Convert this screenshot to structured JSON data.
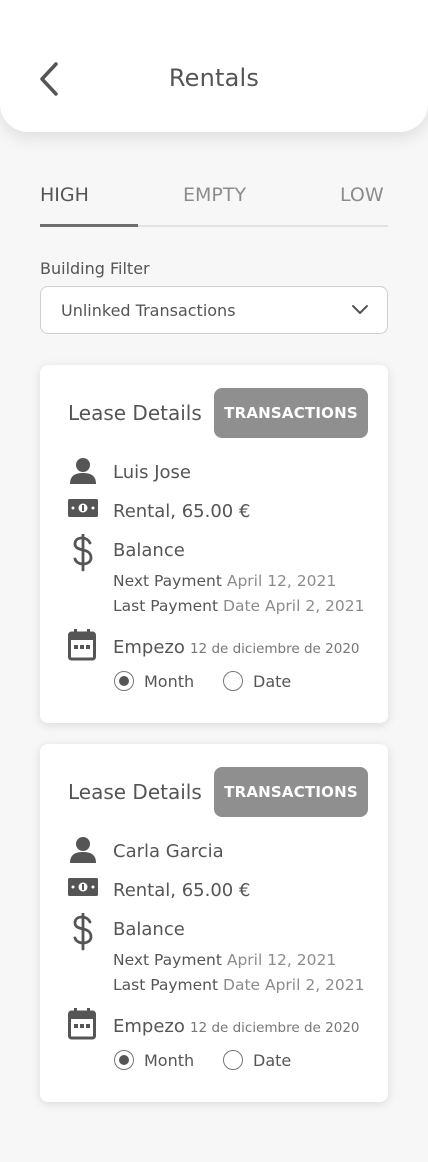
{
  "header": {
    "title": "Rentals",
    "back_icon": "chevron-left-icon"
  },
  "tabs": [
    {
      "label": "HIGH",
      "active": true
    },
    {
      "label": "EMPTY",
      "active": false
    },
    {
      "label": "LOW",
      "active": false
    }
  ],
  "filter": {
    "label": "Building Filter",
    "selected": "Unlinked Transactions"
  },
  "cards": [
    {
      "title": "Lease Details",
      "button_label": "TRANSACTIONS",
      "tenant": "Luis Jose",
      "rental": "Rental, 65.00 €",
      "balance_label": "Balance",
      "next_payment_label": "Next Payment",
      "next_payment_value": "April 12, 2021",
      "last_payment_label": "Last Payment",
      "last_payment_value": "Date April 2, 2021",
      "start_label": "Empezo",
      "start_date": "12 de diciembre de 2020",
      "radio_month": "Month",
      "radio_date": "Date",
      "radio_selected": "Month"
    },
    {
      "title": "Lease Details",
      "button_label": "TRANSACTIONS",
      "tenant": "Carla Garcia",
      "rental": "Rental, 65.00 €",
      "balance_label": "Balance",
      "next_payment_label": "Next Payment",
      "next_payment_value": "April 12, 2021",
      "last_payment_label": "Last Payment",
      "last_payment_value": "Date April 2, 2021",
      "start_label": "Empezo",
      "start_date": "12 de diciembre de 2020",
      "radio_month": "Month",
      "radio_date": "Date",
      "radio_selected": "Month"
    }
  ],
  "colors": {
    "button_bg": "#8f8f8f",
    "text": "#555555",
    "muted": "#8c8c8c"
  }
}
